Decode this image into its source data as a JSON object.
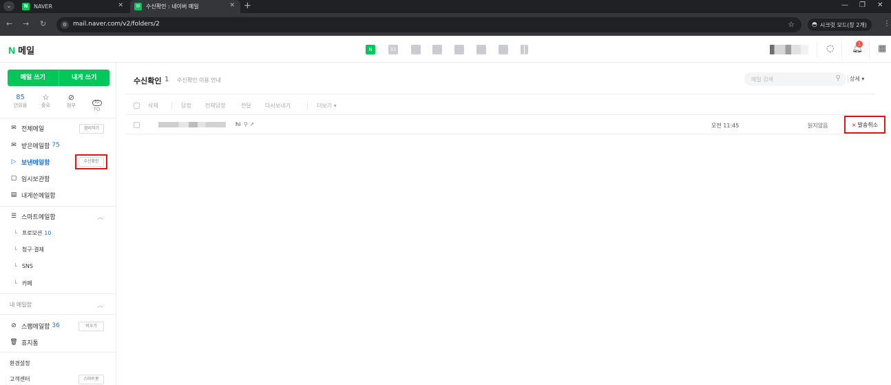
{
  "browser": {
    "tabs": [
      {
        "title": "NAVER",
        "favicon": "N"
      },
      {
        "title": "수신확인 : 네이버 메일",
        "favicon": "mail-icon"
      }
    ],
    "url": "mail.naver.com/v2/folders/2",
    "incognito_label": "시크릿 모드(창 2개)"
  },
  "header": {
    "logo_mark": "N",
    "logo_text": "메일",
    "service_icons": [
      "mail-icon",
      "calendar-icon",
      "memo-icon",
      "contacts-icon",
      "mybox-icon",
      "todo-icon",
      "home-icon",
      "bookmark-icon"
    ],
    "calendar_day": "31",
    "notification_count": "1"
  },
  "sidebar": {
    "compose": "메일 쓰기",
    "self_compose": "내게 쓰기",
    "quick": [
      {
        "value": "85",
        "label": "안읽음"
      },
      {
        "icon": "star-icon",
        "label": "중요"
      },
      {
        "icon": "clip-icon",
        "label": "첨부"
      },
      {
        "icon": "to-icon",
        "icon_text": "TO",
        "label": "TO"
      }
    ],
    "folders": {
      "all": {
        "label": "전체메일",
        "button": "정리하기"
      },
      "inbox": {
        "label": "받은메일함",
        "count": "75"
      },
      "sent": {
        "label": "보낸메일함",
        "button": "수신확인"
      },
      "drafts": {
        "label": "임시보관함"
      },
      "self": {
        "label": "내게쓴메일함"
      }
    },
    "smart": {
      "label": "스마트메일함",
      "items": [
        {
          "label": "프로모션",
          "count": "10"
        },
        {
          "label": "청구·결제"
        },
        {
          "label": "SNS"
        },
        {
          "label": "카페"
        }
      ]
    },
    "my_mailbox": "내 메일함",
    "spam": {
      "label": "스팸메일함",
      "count": "36",
      "button": "비우기"
    },
    "trash": "휴지통",
    "settings": "환경설정",
    "support": {
      "label": "고객센터",
      "button": "스마트봇"
    }
  },
  "main": {
    "title": "수신확인",
    "count": "1",
    "guide": "수신확인 이용 안내",
    "search_placeholder": "메일 검색",
    "detail": "상세 ▾",
    "toolbar": [
      "삭제",
      "답장",
      "전체답장",
      "전달",
      "다시보내기",
      "더보기 ▾"
    ],
    "row": {
      "subject": "hi",
      "time": "오전 11:45",
      "status": "읽지않음",
      "cancel": "발송취소"
    }
  },
  "colors": {
    "naver_green": "#03c75a",
    "link_blue": "#1e6fd9",
    "highlight_red": "#e01414"
  }
}
